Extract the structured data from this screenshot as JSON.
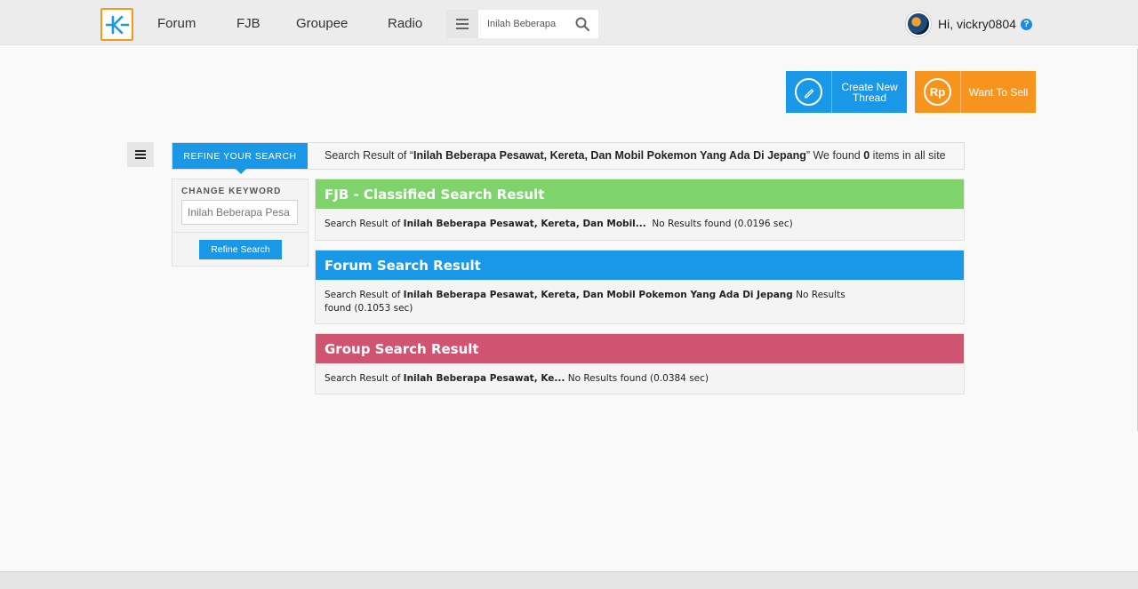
{
  "nav": {
    "links": [
      "Forum",
      "FJB",
      "Groupee",
      "Radio"
    ],
    "search_value": "Inilah Beberapa",
    "user_greeting": "Hi, vickry0804",
    "help_glyph": "?"
  },
  "actions": {
    "create_label_line1": "Create New",
    "create_label_line2": "Thread",
    "sell_label": "Want To Sell",
    "sell_icon_text": "Rp"
  },
  "refine": {
    "tab_label": "REFINE YOUR SEARCH",
    "summary_prefix": "Search Result of “",
    "summary_query": "Inilah Beberapa Pesawat, Kereta, Dan Mobil Pokemon Yang Ada Di Jepang",
    "summary_mid": "” We found ",
    "summary_count": "0",
    "summary_suffix": " items in all site",
    "change_keyword_label": "CHANGE KEYWORD",
    "keyword_placeholder": "Inilah Beberapa Pesa",
    "refine_button": "Refine Search"
  },
  "sections": {
    "fjb": {
      "title": "FJB - Classified Search Result",
      "prefix": "Search Result of ",
      "query": "Inilah Beberapa Pesawat, Kereta, Dan Mobil...",
      "status": "  No Results found (0.0196 sec)"
    },
    "forum": {
      "title": "Forum Search Result",
      "prefix": "Search Result of ",
      "query": "Inilah Beberapa Pesawat, Kereta, Dan Mobil Pokemon Yang Ada Di Jepang",
      "status": " No Results found (0.1053 sec)"
    },
    "group": {
      "title": "Group Search Result",
      "prefix": "Search Result of ",
      "query": "Inilah Beberapa Pesawat, Ke...",
      "status": " No Results found (0.0384 sec)"
    }
  },
  "icons": {
    "logo": "kaskus-logo-icon",
    "menu": "hamburger-icon",
    "search": "search-icon",
    "create": "pencil-icon",
    "sell": "rupiah-icon",
    "sidebar": "hamburger-icon"
  },
  "colors": {
    "primary_blue": "#1a98e8",
    "orange": "#f7941d",
    "fjb_green": "#7fd36b",
    "group_red": "#d05471"
  }
}
